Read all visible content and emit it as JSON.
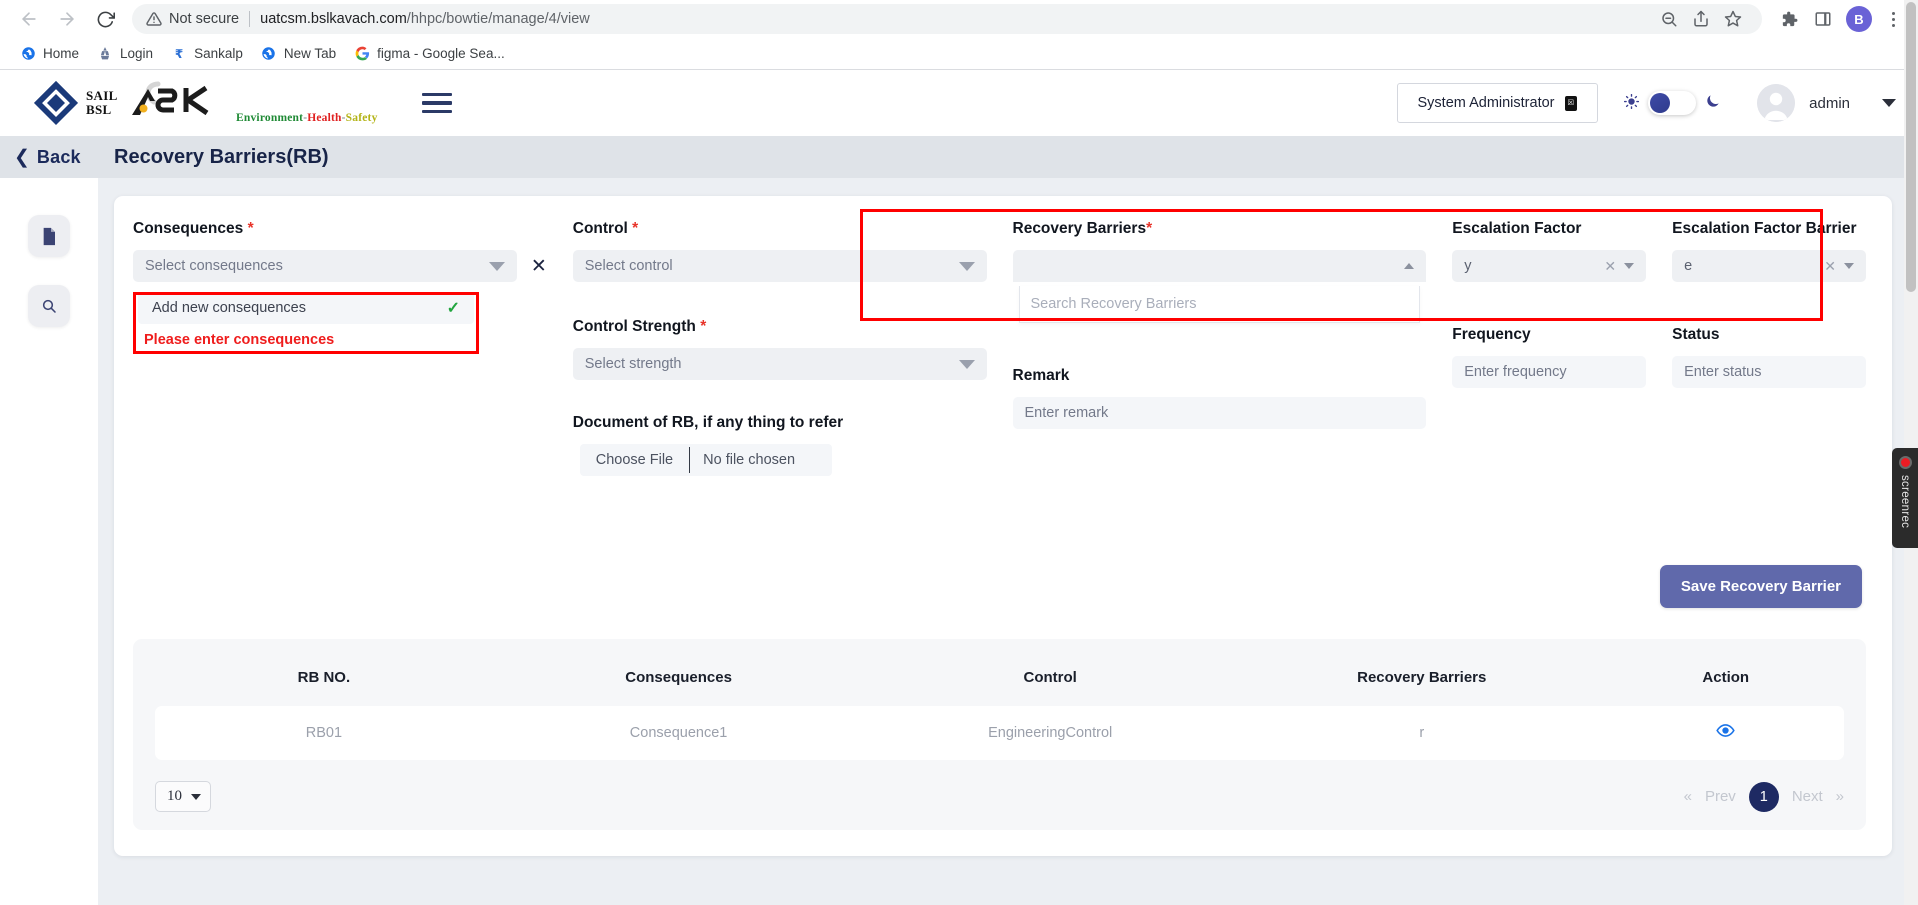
{
  "browser": {
    "back_icon": "back-arrow-icon",
    "forward_icon": "forward-arrow-icon",
    "reload_icon": "reload-icon",
    "security_label": "Not secure",
    "url_host": "uatcsm.bslkavach.com",
    "url_path": "/hhpc/bowtie/manage/4/view",
    "profile_initial": "B",
    "bookmarks": [
      {
        "label": "Home",
        "icon": "globe-icon"
      },
      {
        "label": "Login",
        "icon": "emblem-icon"
      },
      {
        "label": "Sankalp",
        "icon": "rupee-icon"
      },
      {
        "label": "New Tab",
        "icon": "globe-icon"
      },
      {
        "label": "figma - Google Sea...",
        "icon": "google-icon"
      }
    ]
  },
  "header": {
    "logo_sail_line1": "SAIL",
    "logo_sail_line2": "BSL",
    "logo_ask": "ASK",
    "logo_tag_env": "Environment",
    "logo_tag_health": "Health",
    "logo_tag_safety": "Safety",
    "menu_icon": "hamburger-menu-icon",
    "role_label": "System Administrator",
    "role_glyph": "☒",
    "theme_sun_icon": "sun-icon",
    "theme_moon_icon": "moon-icon",
    "user_name": "admin",
    "user_caret_icon": "chevron-down-icon"
  },
  "sidebar": {
    "back_label": "Back",
    "items": [
      {
        "name": "document-icon",
        "glyph": "📄"
      },
      {
        "name": "search-icon",
        "glyph": "🔍"
      }
    ]
  },
  "page": {
    "title": "Recovery Barriers(RB)"
  },
  "form": {
    "consequences": {
      "label": "Consequences",
      "required": "*",
      "placeholder": "Select consequences",
      "clear_icon": "close-icon",
      "add_new_placeholder": "Add new consequences",
      "confirm_icon": "check-icon",
      "error": "Please enter consequences"
    },
    "control": {
      "label": "Control",
      "required": "*",
      "placeholder": "Select control"
    },
    "recovery_barriers": {
      "label": "Recovery Barriers",
      "required": "*",
      "value": "",
      "search_placeholder": "Search Recovery Barriers"
    },
    "escalation_factor": {
      "label": "Escalation Factor",
      "value": "y",
      "clear_icon": "close-icon"
    },
    "escalation_factor_barrier": {
      "label": "Escalation Factor Barrier",
      "value": "e",
      "clear_icon": "close-icon"
    },
    "control_strength": {
      "label": "Control Strength",
      "required": "*",
      "placeholder": "Select strength"
    },
    "remark": {
      "label": "Remark",
      "placeholder": "Enter remark"
    },
    "frequency": {
      "label": "Frequency",
      "placeholder": "Enter frequency"
    },
    "status": {
      "label": "Status",
      "placeholder": "Enter status"
    },
    "document": {
      "label": "Document of RB, if any thing to refer",
      "choose_label": "Choose File",
      "no_file_label": "No file chosen"
    },
    "save_button": "Save Recovery Barrier",
    "highlight_color": "#ff0000",
    "accent_color": "#6069ab"
  },
  "table": {
    "columns": [
      "RB NO.",
      "Consequences",
      "Control",
      "Recovery Barriers",
      "Action"
    ],
    "rows": [
      {
        "rb_no": "RB01",
        "consequences": "Consequence1",
        "control": "EngineeringControl",
        "recovery_barriers": "r",
        "action_icon": "eye-icon"
      }
    ],
    "page_size": "10",
    "pagination": {
      "first": "«",
      "prev": "Prev",
      "current": "1",
      "next": "Next",
      "last": "»"
    }
  },
  "overlay": {
    "screenrec_label": "screenrec",
    "record_icon": "record-dot-icon"
  }
}
